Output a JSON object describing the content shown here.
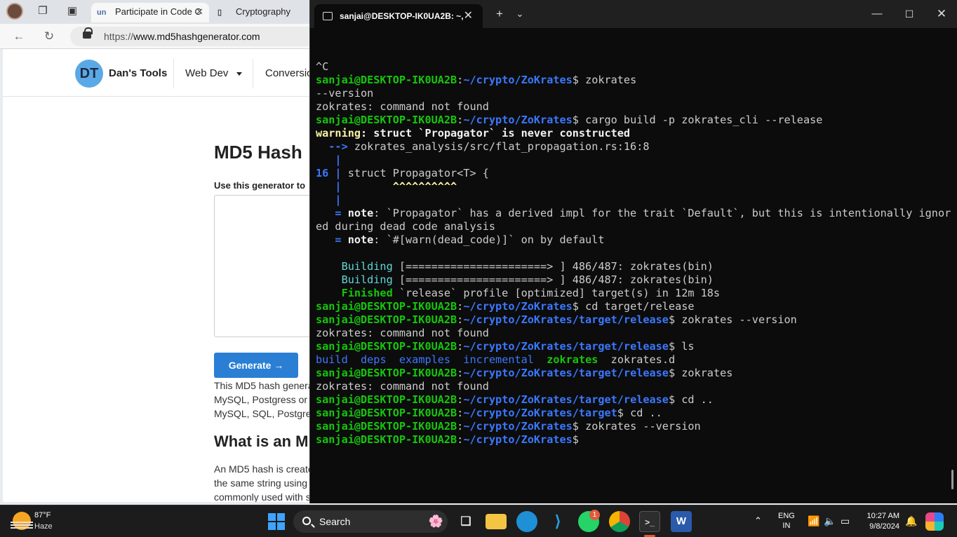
{
  "browser": {
    "tabs": [
      {
        "label": "Participate in Code C",
        "favicon": "un"
      },
      {
        "label": "Cryptography"
      }
    ],
    "url_prefix": "https://",
    "url_host": "www.md5hashgenerator.com"
  },
  "site": {
    "logo": "DT",
    "name": "Dan's Tools",
    "nav": [
      "Web Dev",
      "Conversio"
    ],
    "heading": "MD5 Hash",
    "subheading": "Use this generator to",
    "generate_label": "Generate →",
    "para1": [
      "This MD5 hash generat",
      "MySQL, Postgress or",
      "MySQL, SQL, Postgre"
    ],
    "heading2": "What is an M",
    "para2": [
      "An MD5 hash is create",
      "the same string using",
      "commonly used with s"
    ]
  },
  "terminal": {
    "tab_title": "sanjai@DESKTOP-IK0UA2B: ~,",
    "prompt_user": "sanjai@DESKTOP-IK0UA2B",
    "lines": [
      [
        {
          "t": "^C",
          "c": ""
        }
      ],
      [
        {
          "t": "sanjai@DESKTOP-IK0UA2B",
          "c": "g"
        },
        {
          "t": ":",
          "c": ""
        },
        {
          "t": "~/crypto/ZoKrates",
          "c": "b"
        },
        {
          "t": "$ zokrates",
          "c": ""
        }
      ],
      [
        {
          "t": "--version",
          "c": ""
        }
      ],
      [
        {
          "t": "zokrates: command not found",
          "c": ""
        }
      ],
      [
        {
          "t": "sanjai@DESKTOP-IK0UA2B",
          "c": "g"
        },
        {
          "t": ":",
          "c": ""
        },
        {
          "t": "~/crypto/ZoKrates",
          "c": "b"
        },
        {
          "t": "$ cargo build -p zokrates_cli --release",
          "c": ""
        }
      ],
      [
        {
          "t": "warning",
          "c": "y"
        },
        {
          "t": ": struct `Propagator` is never constructed",
          "c": "w"
        }
      ],
      [
        {
          "t": "  --> ",
          "c": "bh"
        },
        {
          "t": "zokrates_analysis/src/flat_propagation.rs:16:8",
          "c": ""
        }
      ],
      [
        {
          "t": "   |",
          "c": "bh"
        }
      ],
      [
        {
          "t": "16 |",
          "c": "bh"
        },
        {
          "t": " struct Propagator<T> {",
          "c": ""
        }
      ],
      [
        {
          "t": "   |",
          "c": "bh"
        },
        {
          "t": "        ^^^^^^^^^^",
          "c": "y"
        }
      ],
      [
        {
          "t": "   |",
          "c": "bh"
        }
      ],
      [
        {
          "t": "   = ",
          "c": "bh"
        },
        {
          "t": "note",
          "c": "w"
        },
        {
          "t": ": `Propagator` has a derived impl for the trait `Default`, but this is intentionally ignor",
          "c": ""
        }
      ],
      [
        {
          "t": "ed during dead code analysis",
          "c": ""
        }
      ],
      [
        {
          "t": "   = ",
          "c": "bh"
        },
        {
          "t": "note",
          "c": "w"
        },
        {
          "t": ": `#[warn(dead_code)]` on by default",
          "c": ""
        }
      ],
      [
        {
          "t": "",
          "c": ""
        }
      ],
      [
        {
          "t": "    Building",
          "c": "c"
        },
        {
          "t": " [======================> ] 486/487: zokrates(bin)",
          "c": ""
        }
      ],
      [
        {
          "t": "    Building",
          "c": "c"
        },
        {
          "t": " [======================> ] 486/487: zokrates(bin)",
          "c": ""
        }
      ],
      [
        {
          "t": "    Finished",
          "c": "g"
        },
        {
          "t": " `release` profile [optimized] target(s) in 12m 18s",
          "c": ""
        }
      ],
      [
        {
          "t": "sanjai@DESKTOP-IK0UA2B",
          "c": "g"
        },
        {
          "t": ":",
          "c": ""
        },
        {
          "t": "~/crypto/ZoKrates",
          "c": "b"
        },
        {
          "t": "$ cd target/release",
          "c": ""
        }
      ],
      [
        {
          "t": "sanjai@DESKTOP-IK0UA2B",
          "c": "g"
        },
        {
          "t": ":",
          "c": ""
        },
        {
          "t": "~/crypto/ZoKrates/target/release",
          "c": "b"
        },
        {
          "t": "$ zokrates --version",
          "c": ""
        }
      ],
      [
        {
          "t": "zokrates: command not found",
          "c": ""
        }
      ],
      [
        {
          "t": "sanjai@DESKTOP-IK0UA2B",
          "c": "g"
        },
        {
          "t": ":",
          "c": ""
        },
        {
          "t": "~/crypto/ZoKrates/target/release",
          "c": "b"
        },
        {
          "t": "$ ls",
          "c": ""
        }
      ],
      [
        {
          "t": "build",
          "c": "bl"
        },
        {
          "t": "  ",
          "c": ""
        },
        {
          "t": "deps",
          "c": "bl"
        },
        {
          "t": "  ",
          "c": ""
        },
        {
          "t": "examples",
          "c": "bl"
        },
        {
          "t": "  ",
          "c": ""
        },
        {
          "t": "incremental",
          "c": "bl"
        },
        {
          "t": "  ",
          "c": ""
        },
        {
          "t": "zokrates",
          "c": "g"
        },
        {
          "t": "  zokrates.d",
          "c": ""
        }
      ],
      [
        {
          "t": "sanjai@DESKTOP-IK0UA2B",
          "c": "g"
        },
        {
          "t": ":",
          "c": ""
        },
        {
          "t": "~/crypto/ZoKrates/target/release",
          "c": "b"
        },
        {
          "t": "$ zokrates",
          "c": ""
        }
      ],
      [
        {
          "t": "zokrates: command not found",
          "c": ""
        }
      ],
      [
        {
          "t": "sanjai@DESKTOP-IK0UA2B",
          "c": "g"
        },
        {
          "t": ":",
          "c": ""
        },
        {
          "t": "~/crypto/ZoKrates/target/release",
          "c": "b"
        },
        {
          "t": "$ cd ..",
          "c": ""
        }
      ],
      [
        {
          "t": "sanjai@DESKTOP-IK0UA2B",
          "c": "g"
        },
        {
          "t": ":",
          "c": ""
        },
        {
          "t": "~/crypto/ZoKrates/target",
          "c": "b"
        },
        {
          "t": "$ cd ..",
          "c": ""
        }
      ],
      [
        {
          "t": "sanjai@DESKTOP-IK0UA2B",
          "c": "g"
        },
        {
          "t": ":",
          "c": ""
        },
        {
          "t": "~/crypto/ZoKrates",
          "c": "b"
        },
        {
          "t": "$ zokrates --version",
          "c": ""
        }
      ],
      [
        {
          "t": "sanjai@DESKTOP-IK0UA2B",
          "c": "g"
        },
        {
          "t": ":",
          "c": ""
        },
        {
          "t": "~/crypto/ZoKrates",
          "c": "b"
        },
        {
          "t": "$",
          "c": ""
        }
      ]
    ]
  },
  "taskbar": {
    "temperature": "87°F",
    "condition": "Haze",
    "search_placeholder": "Search",
    "whatsapp_badge": "1",
    "lang_top": "ENG",
    "lang_bottom": "IN",
    "time": "10:27 AM",
    "date": "9/8/2024"
  },
  "colors": {
    "terminal_bg": "#0c0c0c",
    "prompt_green": "#16c60c",
    "path_blue": "#3b78ff",
    "generate_blue": "#2a7fd4"
  }
}
